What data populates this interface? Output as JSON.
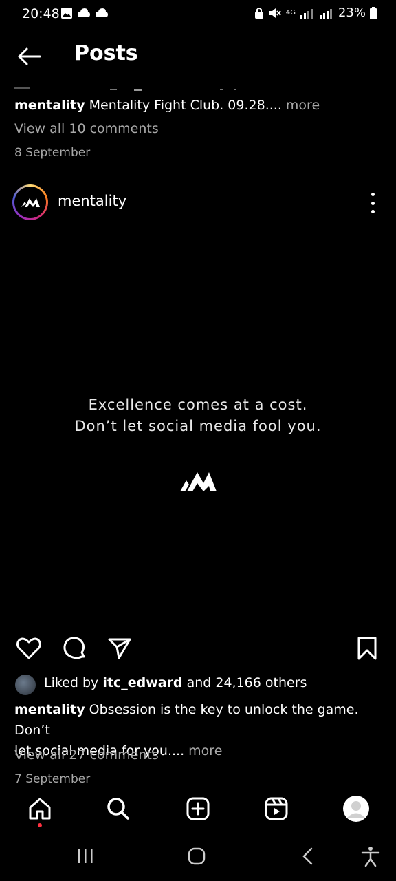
{
  "status_bar": {
    "time": "20:48",
    "battery": "23%",
    "network": "4G"
  },
  "header": {
    "title": "Posts"
  },
  "prev_post": {
    "caption_user": "mentality",
    "caption_text": "Mentality Fight Club. 09.28....",
    "more_label": "more",
    "view_comments": "View all 10 comments",
    "date": "8 September"
  },
  "post": {
    "username": "mentality",
    "quote_line1": "Excellence comes at a cost.",
    "quote_line2": "Don’t let social media fool you.",
    "liked_by_prefix": "Liked by",
    "liked_by_user": "itc_edward",
    "liked_by_suffix": "and 24,166 others",
    "caption_user": "mentality",
    "caption_line1": "Obsession is the key to unlock the game. Don’t",
    "caption_line2": "let social media for you....",
    "more_label": "more",
    "view_comments": "View all 27 comments",
    "date": "7 September"
  },
  "icons": {
    "back": "arrow-left-icon",
    "like": "heart-icon",
    "comment": "comment-icon",
    "share": "send-icon",
    "save": "bookmark-icon",
    "nav_home": "home-icon",
    "nav_search": "search-icon",
    "nav_create": "plus-square-icon",
    "nav_reels": "reels-icon",
    "nav_profile": "profile-avatar-icon"
  },
  "colors": {
    "background": "#000000",
    "muted_text": "#a8a8a8",
    "notification_dot": "#ff3040"
  }
}
